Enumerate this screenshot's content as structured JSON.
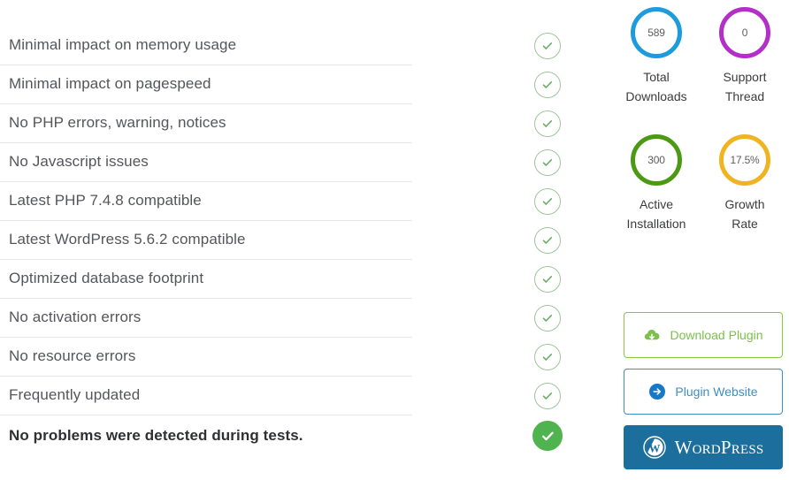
{
  "checklist": {
    "items": [
      {
        "label": "Minimal impact on memory usage",
        "status_icon": "check-circle-icon",
        "passed": true
      },
      {
        "label": "Minimal impact on pagespeed",
        "status_icon": "check-circle-icon",
        "passed": true
      },
      {
        "label": "No PHP errors, warning, notices",
        "status_icon": "check-circle-icon",
        "passed": true
      },
      {
        "label": "No Javascript issues",
        "status_icon": "check-circle-icon",
        "passed": true
      },
      {
        "label": "Latest PHP 7.4.8 compatible",
        "status_icon": "check-circle-icon",
        "passed": true
      },
      {
        "label": "Latest WordPress 5.6.2 compatible",
        "status_icon": "check-circle-icon",
        "passed": true
      },
      {
        "label": "Optimized database footprint",
        "status_icon": "check-circle-icon",
        "passed": true
      },
      {
        "label": "No activation errors",
        "status_icon": "check-circle-icon",
        "passed": true
      },
      {
        "label": "No resource errors",
        "status_icon": "check-circle-icon",
        "passed": true
      },
      {
        "label": "Frequently updated",
        "status_icon": "check-circle-icon",
        "passed": true
      }
    ],
    "summary": {
      "label": "No problems were detected during tests.",
      "status_icon": "check-circle-filled-icon"
    }
  },
  "stats": [
    {
      "value": "589",
      "label_line1": "Total",
      "label_line2": "Downloads",
      "color": "#1e9bdd"
    },
    {
      "value": "0",
      "label_line1": "Support",
      "label_line2": "Thread",
      "color": "#b32fc7"
    },
    {
      "value": "300",
      "label_line1": "Active",
      "label_line2": "Installation",
      "color": "#4c9a13"
    },
    {
      "value": "17.5%",
      "label_line1": "Growth",
      "label_line2": "Rate",
      "color": "#f0b420"
    }
  ],
  "buttons": {
    "download": {
      "label": "Download Plugin",
      "icon": "cloud-download-icon",
      "color": "#7cc04b"
    },
    "website": {
      "label": "Plugin Website",
      "icon": "arrow-right-circle-icon",
      "color": "#3d8fc6"
    },
    "wordpress": {
      "label": "WordPress",
      "icon": "wordpress-logo-icon",
      "color": "#1c6f9c"
    }
  },
  "colors": {
    "check_outline": "#9ec69c",
    "check_fill": "#4fb34f",
    "divider": "#e8e8e8",
    "text": "#54565a"
  }
}
